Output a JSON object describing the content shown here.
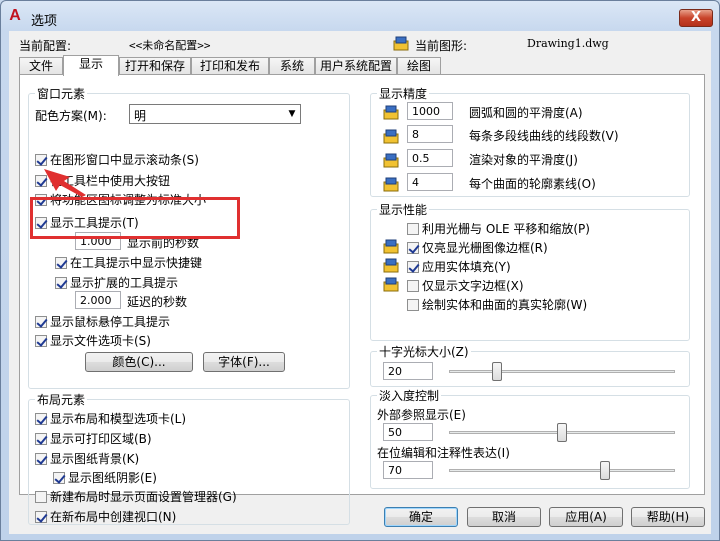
{
  "window": {
    "title": "选项",
    "close_label": "X"
  },
  "header": {
    "current_profile_label": "当前配置:",
    "current_profile_value": "<<未命名配置>>",
    "current_drawing_label": "当前图形:",
    "current_drawing_value": "Drawing1.dwg"
  },
  "tabs": [
    "文件",
    "显示",
    "打开和保存",
    "打印和发布",
    "系统",
    "用户系统配置",
    "绘图"
  ],
  "window_elements": {
    "title": "窗口元素",
    "color_scheme_label": "配色方案(M):",
    "color_scheme_value": "明",
    "show_scrollbars": "在图形窗口中显示滚动条(S)",
    "large_buttons": "在工具栏中使用大按钮",
    "resize_ribbon_icons": "将功能区图标调整为标准大小",
    "show_tooltips": "显示工具提示(T)",
    "tooltip_delay_value": "1.000",
    "tooltip_delay_label": "显示前的秒数",
    "show_shortcut_keys": "在工具提示中显示快捷键",
    "show_extended_tooltips": "显示扩展的工具提示",
    "extended_delay_value": "2.000",
    "extended_delay_label": "延迟的秒数",
    "show_rollover_tooltips": "显示鼠标悬停工具提示",
    "show_file_tabs": "显示文件选项卡(S)",
    "colors_button": "颜色(C)...",
    "fonts_button": "字体(F)..."
  },
  "layout_elements": {
    "title": "布局元素",
    "show_layout_tabs": "显示布局和模型选项卡(L)",
    "show_printable_area": "显示可打印区域(B)",
    "show_paper_background": "显示图纸背景(K)",
    "show_paper_shadow": "显示图纸阴影(E)",
    "show_page_setup_manager": "新建布局时显示页面设置管理器(G)",
    "create_viewport": "在新布局中创建视口(N)"
  },
  "display_resolution": {
    "title": "显示精度",
    "rows": [
      {
        "value": "1000",
        "label": "圆弧和圆的平滑度(A)"
      },
      {
        "value": "8",
        "label": "每条多段线曲线的线段数(V)"
      },
      {
        "value": "0.5",
        "label": "渲染对象的平滑度(J)"
      },
      {
        "value": "4",
        "label": "每个曲面的轮廓素线(O)"
      }
    ]
  },
  "display_performance": {
    "title": "显示性能",
    "items": [
      {
        "label": "利用光栅与 OLE 平移和缩放(P)",
        "checked": false
      },
      {
        "label": "仅亮显光栅图像边框(R)",
        "checked": true
      },
      {
        "label": "应用实体填充(Y)",
        "checked": true
      },
      {
        "label": "仅显示文字边框(X)",
        "checked": false
      },
      {
        "label": "绘制实体和曲面的真实轮廓(W)",
        "checked": false
      }
    ]
  },
  "crosshair": {
    "title": "十字光标大小(Z)",
    "value": "20",
    "fraction": 0.2
  },
  "fade_control": {
    "title": "淡入度控制",
    "xref_label": "外部参照显示(E)",
    "xref_value": "50",
    "xref_fraction": 0.5,
    "inplace_label": "在位编辑和注释性表达(I)",
    "inplace_value": "70",
    "inplace_fraction": 0.7
  },
  "footer": {
    "ok": "确定",
    "cancel": "取消",
    "apply": "应用(A)",
    "help": "帮助(H)"
  },
  "colors": {
    "annotation_red": "#e03030",
    "titlebar_close": "#c8432a"
  }
}
